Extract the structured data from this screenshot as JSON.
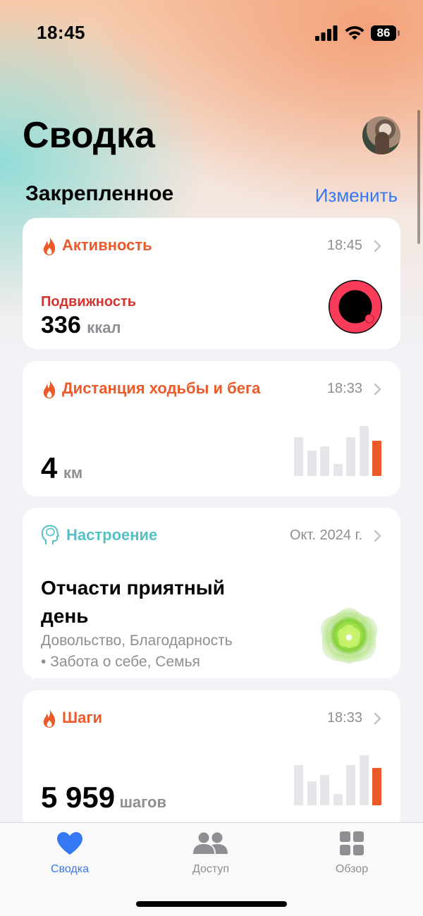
{
  "status_bar": {
    "time": "18:45",
    "battery": "86"
  },
  "header": {
    "title": "Сводка",
    "section": "Закрепленное",
    "edit": "Изменить"
  },
  "cards": {
    "activity": {
      "title": "Активность",
      "time": "18:45",
      "metric_label": "Подвижность",
      "value": "336",
      "unit": "ккал",
      "ring_color": "#fa3c5a"
    },
    "distance": {
      "title": "Дистанция ходьбы и бега",
      "time": "18:33",
      "value": "4",
      "unit": "км",
      "bars": [
        0.78,
        0.5,
        0.59,
        0.24,
        0.78,
        1.0,
        0.7
      ]
    },
    "mood": {
      "title": "Настроение",
      "time": "Окт. 2024 г.",
      "headline_line1": "Отчасти приятный",
      "headline_line2": "день",
      "tags_line1": "Довольство, Благодарность",
      "tags_line2": "• Забота о себе, Семья"
    },
    "steps": {
      "title": "Шаги",
      "time": "18:33",
      "value": "5 959",
      "unit": "шагов",
      "bars": [
        0.8,
        0.48,
        0.6,
        0.22,
        0.8,
        1.0,
        0.74
      ]
    }
  },
  "tabs": [
    {
      "label": "Сводка",
      "active": true
    },
    {
      "label": "Доступ",
      "active": false
    },
    {
      "label": "Обзор",
      "active": false
    }
  ],
  "colors": {
    "accent": "#3478f6",
    "activity": "#eb5a28",
    "mood": "#55c0c5",
    "mobility": "#d6332e"
  }
}
